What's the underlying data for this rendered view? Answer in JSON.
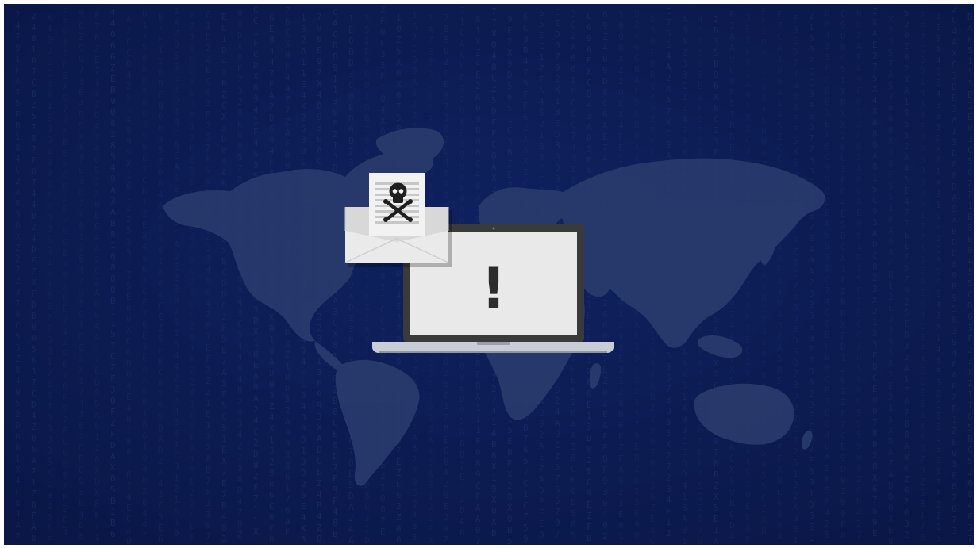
{
  "scene": {
    "background_color": "#0b1a4e",
    "matrix_glyph_color": "#1b2d66",
    "world_map_color": "#2e4070",
    "envelope": {
      "icon": "envelope-with-skull-icon",
      "letter_color": "#f2f2f2",
      "line_color": "#c9c9c9",
      "skull_color": "#1f1f1f",
      "envelope_color": "#e8e8e8"
    },
    "laptop": {
      "icon": "laptop-icon",
      "screen_bezel_color": "#3a3a3a",
      "screen_color": "#e9e9e9",
      "base_color": "#c9ced6",
      "warning_glyph": "!",
      "warning_color": "#2c2c2c"
    }
  }
}
